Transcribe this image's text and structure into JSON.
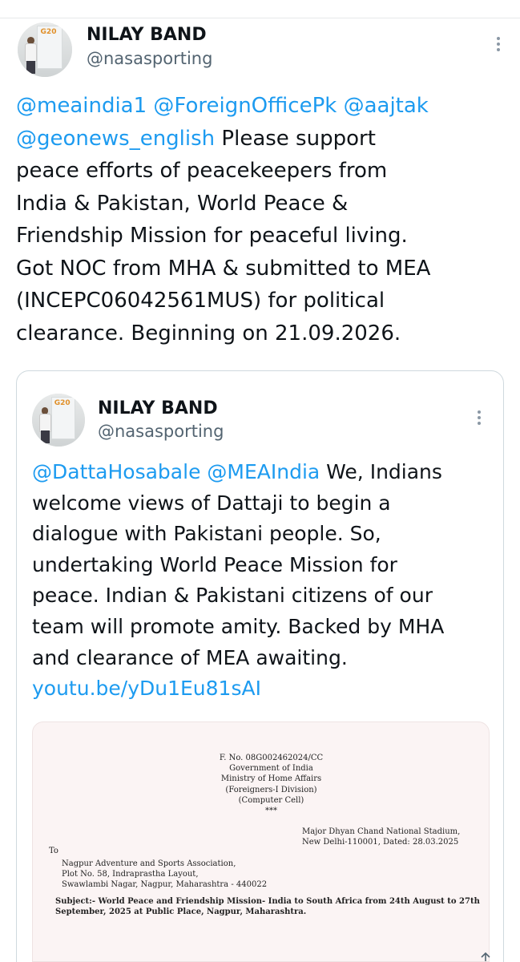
{
  "main_tweet": {
    "author_name": "NILAY BAND",
    "author_handle": "@nasasporting",
    "text_lines": [
      [
        {
          "t": "@meaindia1 @ForeignOfficePk @aajtak",
          "k": "mention"
        }
      ],
      [
        {
          "t": "@geonews_english",
          "k": "mention"
        },
        {
          "t": " Please support",
          "k": "text"
        }
      ],
      [
        {
          "t": "peace efforts of peacekeepers from",
          "k": "text"
        }
      ],
      [
        {
          "t": "India & Pakistan, World Peace &",
          "k": "text"
        }
      ],
      [
        {
          "t": "Friendship Mission for peaceful living.",
          "k": "text"
        }
      ],
      [
        {
          "t": "Got NOC from MHA & submitted to MEA",
          "k": "text"
        }
      ],
      [
        {
          "t": "(INCEPC06042561MUS) for political",
          "k": "text"
        }
      ],
      [
        {
          "t": "clearance. Beginning on 21.09.2026.",
          "k": "text"
        }
      ]
    ]
  },
  "quoted_tweet": {
    "author_name": "NILAY BAND",
    "author_handle": "@nasasporting",
    "text_lines": [
      [
        {
          "t": "@DattaHosabale @MEAIndia",
          "k": "mention"
        },
        {
          "t": " We, Indians",
          "k": "text"
        }
      ],
      [
        {
          "t": "welcome views of Dattaji to begin a",
          "k": "text"
        }
      ],
      [
        {
          "t": "dialogue with Pakistani people. So,",
          "k": "text"
        }
      ],
      [
        {
          "t": "undertaking World Peace Mission for",
          "k": "text"
        }
      ],
      [
        {
          "t": "peace. Indian & Pakistani citizens of our",
          "k": "text"
        }
      ],
      [
        {
          "t": "team will promote amity. Backed by MHA",
          "k": "text"
        }
      ],
      [
        {
          "t": "and clearance of MEA awaiting.",
          "k": "text"
        }
      ],
      [
        {
          "t": "youtu.be/yDu1Eu81sAI",
          "k": "link"
        }
      ]
    ],
    "document": {
      "header": [
        "F. No. 08G002462024/CC",
        "Government of India",
        "Ministry of Home Affairs",
        "(Foreigners-I Division)",
        "(Computer Cell)",
        "***"
      ],
      "address_right": [
        "Major Dhyan Chand National Stadium,",
        "New Delhi-110001, Dated:  28.03.2025"
      ],
      "to_label": "To",
      "to_lines": [
        "Nagpur Adventure and Sports Association,",
        "Plot No. 58, Indraprastha Layout,",
        "Swawlambi Nagar, Nagpur, Maharashtra - 440022"
      ],
      "subject_lines": [
        "Subject:- World Peace and Friendship Mission- India to South Africa from 24th  August to 27th",
        "September, 2025 at Public Place, Nagpur, Maharashtra."
      ]
    }
  },
  "icons": {
    "more": "more-options-icon",
    "share": "share-icon"
  }
}
